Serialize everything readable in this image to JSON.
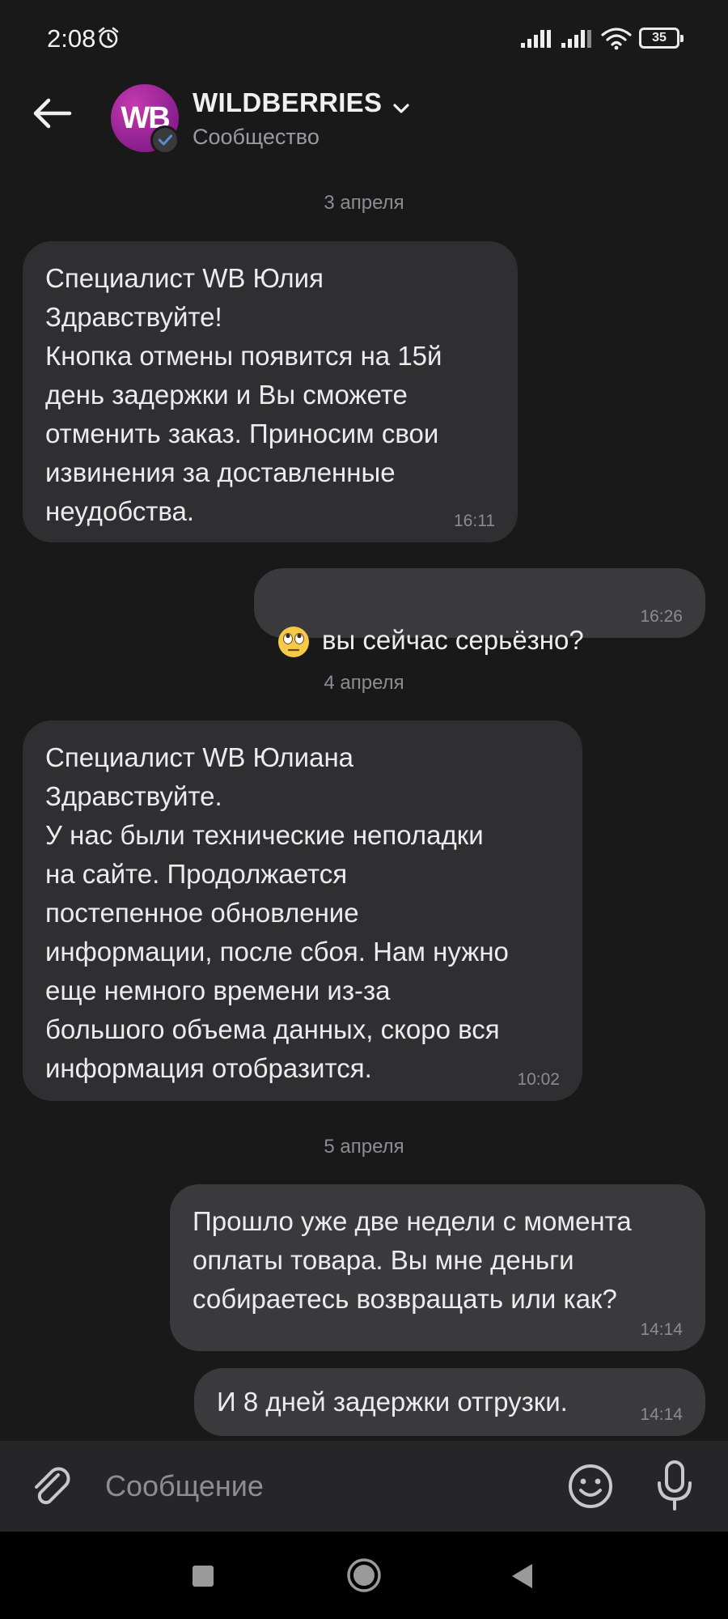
{
  "status_bar": {
    "time": "2:08",
    "battery": "35",
    "icons": [
      "alarm-icon",
      "signal-icon",
      "signal-icon",
      "wifi-icon",
      "battery-icon"
    ]
  },
  "header": {
    "avatar_text": "WB",
    "title": "WILDBERRIES",
    "subtitle": "Сообщество",
    "avatar_color": "#9b2496",
    "verified": true
  },
  "messages": [
    {
      "type": "date",
      "text": "3 апреля"
    },
    {
      "type": "incoming",
      "text": "Специалист WB Юлия\nЗдравствуйте!\nКнопка отмены появится на 15й\nдень задержки и Вы сможете\nотменить заказ. Приносим свои\nизвинения за доставленные\nнеудобства.",
      "time": "16:11"
    },
    {
      "type": "outgoing",
      "emoji": "face-with-rolling-eyes",
      "text": "вы сейчас серьёзно?",
      "time": "16:26"
    },
    {
      "type": "date",
      "text": "4 апреля"
    },
    {
      "type": "incoming",
      "text": "Специалист WB Юлиана\nЗдравствуйте.\nУ нас были технические неполадки\nна сайте. Продолжается\nпостепенное обновление\nинформации, после сбоя. Нам нужно\nеще немного времени из-за\nбольшого объема данных, скоро вся\nинформация отобразится.",
      "time": "10:02"
    },
    {
      "type": "date",
      "text": "5 апреля"
    },
    {
      "type": "outgoing",
      "text": "Прошло уже две недели с момента\nоплаты товара. Вы мне деньги\nсобираетесь возвращать или как?",
      "time": "14:14"
    },
    {
      "type": "outgoing",
      "text": "И 8 дней задержки отгрузки.",
      "time": "14:14"
    }
  ],
  "composer": {
    "placeholder": "Сообщение"
  },
  "colors": {
    "background": "#19191a",
    "incoming_bubble": "#2f2f31",
    "outgoing_bubble": "#3a3a3c",
    "composer": "#262628",
    "verified_check": "#5b8dd6"
  }
}
